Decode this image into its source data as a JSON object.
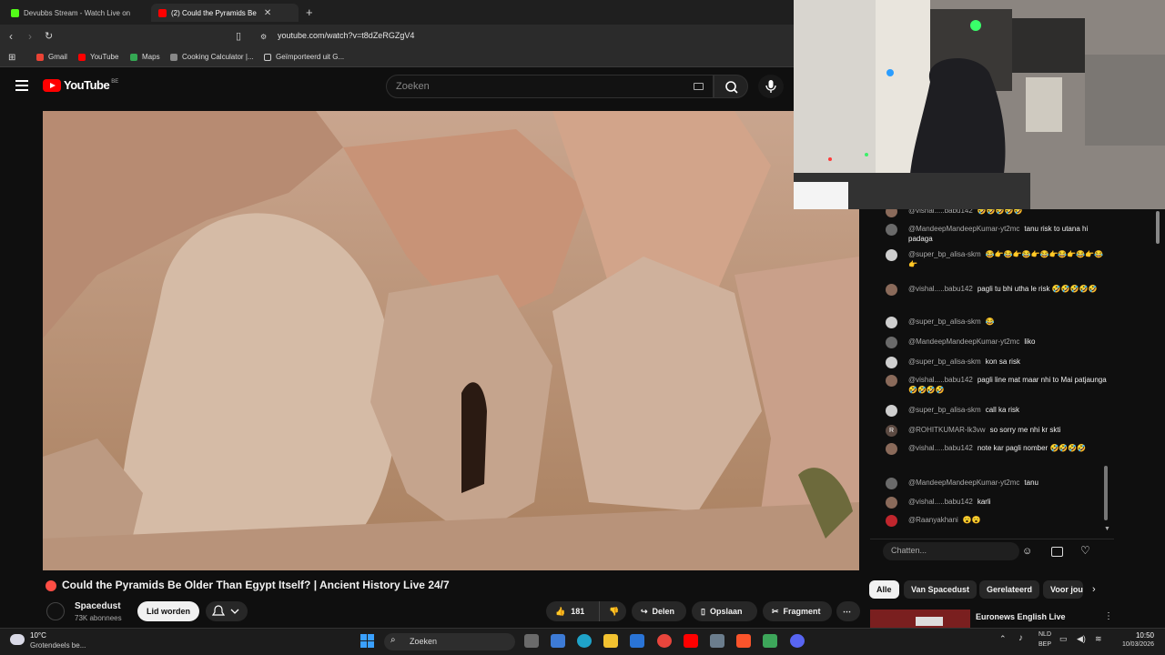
{
  "browser": {
    "tabs": [
      {
        "label": "Devubbs Stream - Watch Live on",
        "favicon_color": "#53fc18",
        "active": false
      },
      {
        "label": "(2) Could the Pyramids Be",
        "favicon_color": "#ff0000",
        "active": true
      }
    ],
    "url": "youtube.com/watch?v=t8dZeRGZgV4",
    "bookmarks": [
      {
        "label": "Gmail",
        "color": "#ea4335"
      },
      {
        "label": "YouTube",
        "color": "#ff0000"
      },
      {
        "label": "Maps",
        "color": "#34a853"
      },
      {
        "label": "Cooking Calculator |...",
        "color": "#888888"
      },
      {
        "label": "Geïmporteerd uit G...",
        "color": "#cccccc"
      }
    ]
  },
  "header": {
    "logo_text": "YouTube",
    "country_code": "BE",
    "search_placeholder": "Zoeken"
  },
  "video": {
    "title": "Could the Pyramids Be Older Than Egypt Itself? | Ancient History Live 24/7",
    "channel": "Spacedust",
    "subscribers": "73K abonnees",
    "join_label": "Lid worden",
    "like_count": "181",
    "share_label": "Delen",
    "save_label": "Opslaan",
    "clip_label": "Fragment"
  },
  "chat": {
    "messages": [
      {
        "author": "@vishal.....babu142",
        "text": "🤣🤣🤣🤣🤣",
        "avatar": "",
        "avatar_color": "#8a6a5a"
      },
      {
        "author": "@MandeepMandeepKumar-yt2mc",
        "text": "tanu risk to utana hi padaga",
        "avatar": "",
        "avatar_color": "#6a6a6a"
      },
      {
        "author": "@super_bp_alisa-skm",
        "text": "😂👉😂👉😂👉😂👉😂👉😂👉😂👉",
        "avatar": "",
        "avatar_color": "#cfcfcf"
      },
      {
        "author": "@vishal.....babu142",
        "text": "pagli tu bhi utha le risk 🤣🤣🤣🤣🤣",
        "avatar": "",
        "avatar_color": "#8a6a5a"
      },
      {
        "author": "@super_bp_alisa-skm",
        "text": "😂",
        "avatar": "",
        "avatar_color": "#cfcfcf"
      },
      {
        "author": "@MandeepMandeepKumar-yt2mc",
        "text": "liko",
        "avatar": "",
        "avatar_color": "#6a6a6a"
      },
      {
        "author": "@super_bp_alisa-skm",
        "text": "kon sa risk",
        "avatar": "",
        "avatar_color": "#cfcfcf"
      },
      {
        "author": "@vishal.....babu142",
        "text": "pagli line mat maar nhi to Mai patjaunga 🤣🤣🤣🤣",
        "avatar": "",
        "avatar_color": "#8a6a5a"
      },
      {
        "author": "@super_bp_alisa-skm",
        "text": "call ka risk",
        "avatar": "",
        "avatar_color": "#cfcfcf"
      },
      {
        "author": "@ROHITKUMAR-lk3vw",
        "text": "so sorry me nhi kr skti",
        "avatar": "R",
        "avatar_color": "#5c4a42"
      },
      {
        "author": "@vishal.....babu142",
        "text": "note kar pagli nomber 🤣🤣🤣🤣",
        "avatar": "",
        "avatar_color": "#8a6a5a"
      },
      {
        "author": "@MandeepMandeepKumar-yt2mc",
        "text": "tanu",
        "avatar": "",
        "avatar_color": "#6a6a6a"
      },
      {
        "author": "@vishal.....babu142",
        "text": "karli",
        "avatar": "",
        "avatar_color": "#8a6a5a"
      },
      {
        "author": "@Raanyakhani",
        "text": "😮😮",
        "avatar": "",
        "avatar_color": "#c0262d"
      }
    ],
    "input_placeholder": "Chatten..."
  },
  "related": {
    "chips": [
      "Alle",
      "Van Spacedust",
      "Gerelateerd",
      "Voor jou"
    ],
    "first_title": "Euronews English Live"
  },
  "taskbar": {
    "weather_temp": "10°C",
    "weather_desc": "Grotendeels be...",
    "search_label": "Zoeken",
    "lang_1": "NLD",
    "lang_2": "BEP",
    "time": "10:50",
    "date": "10/03/2026"
  },
  "colors": {
    "accent_red": "#ff0000",
    "live_red": "#ff4e45",
    "background": "#0f0f0f"
  }
}
